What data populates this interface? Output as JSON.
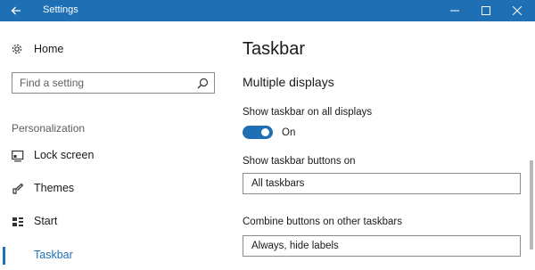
{
  "window": {
    "title": "Settings",
    "accent": "#1e6fb3",
    "controls": [
      "minimize-icon",
      "maximize-icon",
      "close-icon"
    ]
  },
  "sidebar": {
    "home_label": "Home",
    "search_placeholder": "Find a setting",
    "section_label": "Personalization",
    "items": [
      {
        "label": "Lock screen",
        "icon": "lock-screen-icon"
      },
      {
        "label": "Themes",
        "icon": "themes-brush-icon"
      },
      {
        "label": "Start",
        "icon": "start-icon"
      },
      {
        "label": "Taskbar",
        "icon": "taskbar-icon",
        "active": true
      }
    ]
  },
  "main": {
    "title": "Taskbar",
    "subtitle": "Multiple displays",
    "show_on_all_label": "Show taskbar on all displays",
    "toggle_state": "On",
    "buttons_on_label": "Show taskbar buttons on",
    "buttons_on_value": "All taskbars",
    "combine_label": "Combine buttons on other taskbars",
    "combine_value": "Always, hide labels"
  }
}
